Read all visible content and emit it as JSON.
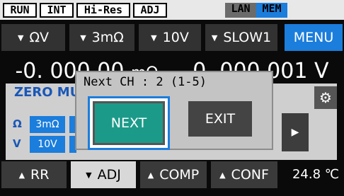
{
  "status_tags": [
    "RUN",
    "INT",
    "Hi-Res",
    "ADJ",
    "LAN",
    "MEM"
  ],
  "range_buttons": [
    {
      "label": "ΩV"
    },
    {
      "label": "3mΩ"
    },
    {
      "label": "10V"
    },
    {
      "label": "SLOW1"
    }
  ],
  "menu_label": "MENU",
  "reading": {
    "resistance": "-0. 000 00",
    "resistance_unit": "mΩ",
    "voltage": "-0. 000 001",
    "voltage_unit": "V"
  },
  "panel": {
    "zero_label": "ZERO MU",
    "row_ohm_label": "Ω",
    "row_ohm_value": "3mΩ",
    "row_v_label": "V",
    "row_v_value": "10V",
    "gear_icon": "gear-icon",
    "arrow_icon": "triangle-right-icon"
  },
  "dialog": {
    "title": "Next CH : 2 (1-5)",
    "next_label": "NEXT",
    "exit_label": "EXIT"
  },
  "bottom_buttons": [
    {
      "label": "RR",
      "direction": "up"
    },
    {
      "label": "ADJ",
      "direction": "down"
    },
    {
      "label": "COMP",
      "direction": "up"
    },
    {
      "label": "CONF",
      "direction": "up"
    }
  ],
  "temperature": "24.8 ℃",
  "colors": {
    "accent_blue": "#1b7ddc",
    "next_teal": "#1c9a89",
    "label_blue": "#1a57b7"
  }
}
